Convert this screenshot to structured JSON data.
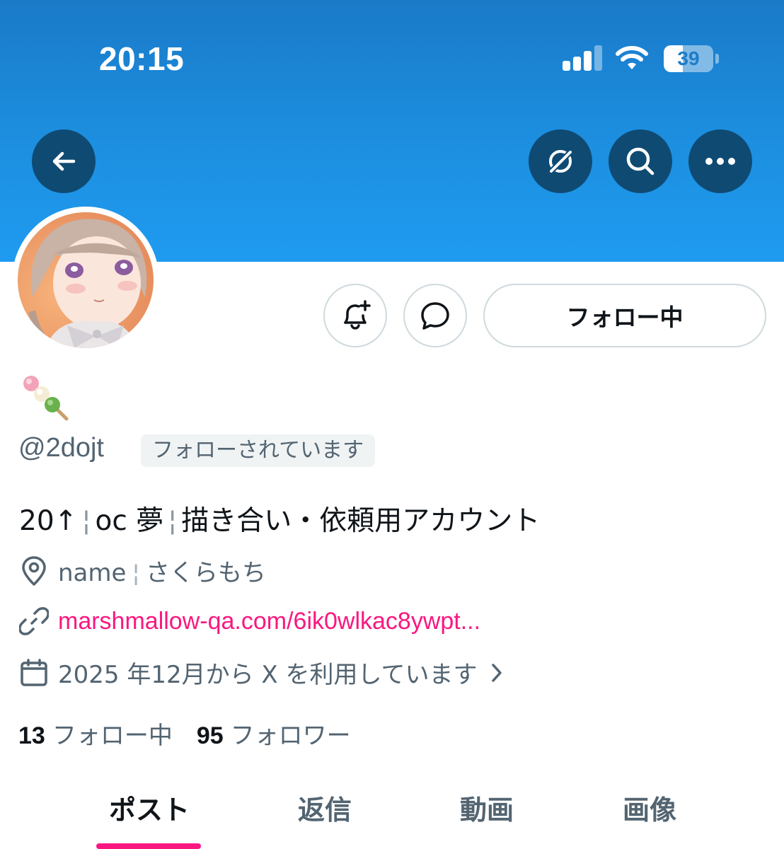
{
  "status_bar": {
    "time": "20:15",
    "battery_level": "39",
    "signal_bars_active": 3,
    "signal_bars_total": 4
  },
  "header": {
    "back_icon": "arrow-left-icon",
    "grok_icon": "grok-icon",
    "search_icon": "search-icon",
    "more_icon": "more-horizontal-icon"
  },
  "profile": {
    "display_name_emoji": "🍡",
    "handle": "@2dojt",
    "follows_you_label": "フォローされています",
    "bio_parts": [
      "20↑",
      "oc 夢",
      "描き合い・依頼用アカウント"
    ],
    "bio_separator": "¦",
    "location_label": "name",
    "location_value": "さくらもち",
    "location_separator": "¦",
    "link": "marshmallow-qa.com/6ik0wlkac8ywpt...",
    "joined": "2025 年12月から X を利用しています",
    "following_count": "13",
    "following_label": "フォロー中",
    "followers_count": "95",
    "followers_label": "フォロワー"
  },
  "actions": {
    "notify_icon": "bell-plus-icon",
    "message_icon": "message-bubble-icon",
    "follow_label": "フォロー中"
  },
  "tabs": [
    {
      "label": "ポスト",
      "active": true
    },
    {
      "label": "返信",
      "active": false
    },
    {
      "label": "動画",
      "active": false
    },
    {
      "label": "画像",
      "active": false
    }
  ],
  "colors": {
    "banner": "#1e9bf0",
    "accent": "#f91880",
    "header_button": "#0f4a73",
    "muted_text": "#536471"
  }
}
